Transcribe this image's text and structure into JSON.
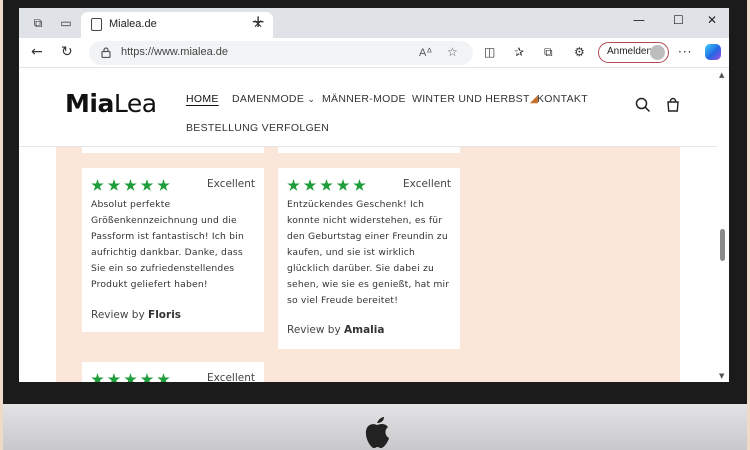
{
  "browser": {
    "tab_title": "Mialea.de",
    "tab_close": "✕",
    "new_tab": "+",
    "url": "https://www.mialea.de",
    "signin_label": "Anmelden",
    "window_controls": {
      "minimize": "—",
      "maximize": "☐",
      "close": "✕"
    }
  },
  "site": {
    "logo_part1": "Mia",
    "logo_part2": "Lea",
    "nav": {
      "home": "HOME",
      "damenmode": "DAMENMODE",
      "maennermode": "MÄNNER-MODE",
      "winter": "WINTER UND HERBST",
      "kontakt": "KONTAKT",
      "bestellung": "BESTELLUNG VERFOLGEN"
    }
  },
  "reviews": [
    {
      "rating_label": "Excellent",
      "stars": 5,
      "lines": [
        "Absolut perfekte",
        "Größenkennzeichnung und die",
        "Passform ist fantastisch! Ich bin",
        "aufrichtig dankbar. Danke, dass",
        "Sie ein so zufriedenstellendes",
        "Produkt geliefert haben!"
      ],
      "by_prefix": "Review by",
      "author": "Floris"
    },
    {
      "rating_label": "Excellent",
      "stars": 5,
      "lines": [
        "Entzückendes Geschenk! Ich",
        "konnte nicht widerstehen, es für",
        "den Geburtstag einer Freundin zu",
        "kaufen, und sie ist wirklich",
        "glücklich darüber. Sie dabei zu",
        "sehen, wie sie es genießt, hat mir",
        "so viel Freude bereitet!"
      ],
      "by_prefix": "Review by",
      "author": "Amalia"
    },
    {
      "rating_label": "Excellent",
      "stars": 5
    }
  ],
  "colors": {
    "star_green": "#1f9d3a",
    "review_background": "#fbe7da",
    "signin_border": "#b24a55"
  }
}
